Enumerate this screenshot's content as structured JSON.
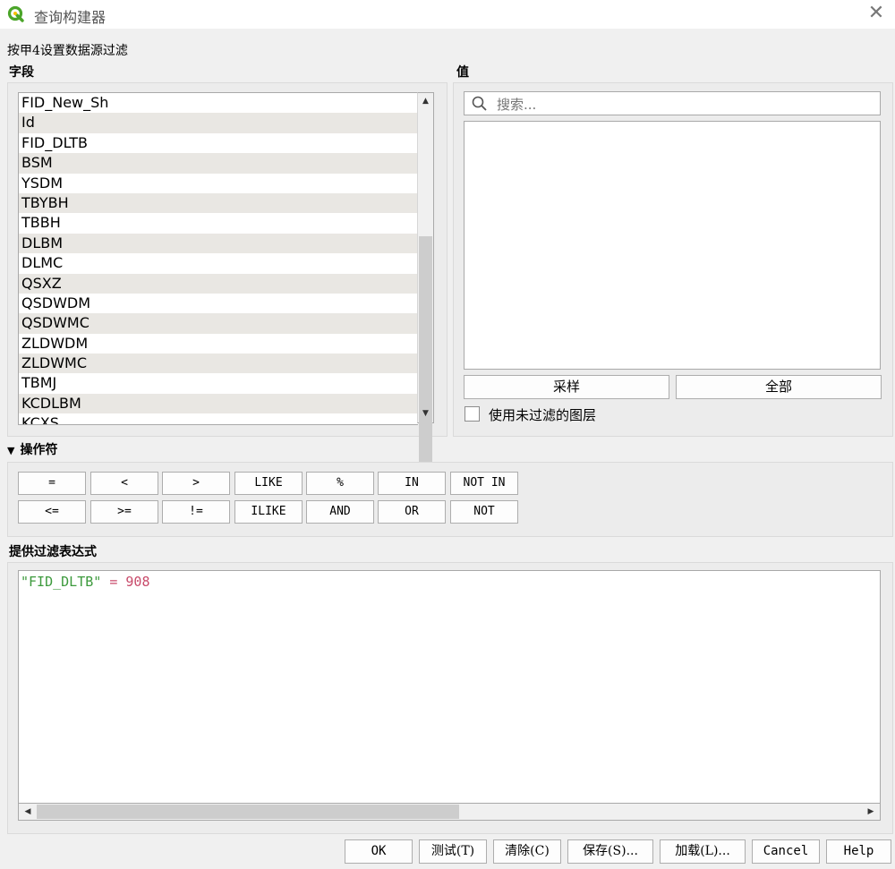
{
  "window": {
    "title": "查询构建器",
    "close_glyph": "✕"
  },
  "source_label": "按甲4设置数据源过滤",
  "fields": {
    "label": "字段",
    "items": [
      "FID_New_Sh",
      "Id",
      "FID_DLTB",
      "BSM",
      "YSDM",
      "TBYBH",
      "TBBH",
      "DLBM",
      "DLMC",
      "QSXZ",
      "QSDWDM",
      "QSDWMC",
      "ZLDWDM",
      "ZLDWMC",
      "TBMJ",
      "KCDLBM",
      "KCXS"
    ]
  },
  "values": {
    "label": "值",
    "search_placeholder": "搜索...",
    "sample_button": "采样",
    "all_button": "全部",
    "use_unfiltered_label": "使用未过滤的图层",
    "use_unfiltered_checked": false
  },
  "operators": {
    "label": "操作符",
    "row1": [
      "=",
      "<",
      ">",
      "LIKE",
      "%",
      "IN",
      "NOT IN"
    ],
    "row2": [
      "<=",
      ">=",
      "!=",
      "ILIKE",
      "AND",
      "OR",
      "NOT"
    ]
  },
  "expression": {
    "label": "提供过滤表达式",
    "field_token": "\"FID_DLTB\"",
    "operator_token": "=",
    "value_token": "908"
  },
  "buttons": {
    "ok": "OK",
    "test": "测试(T)",
    "clear": "清除(C)",
    "save": "保存(S)...",
    "load": "加载(L)...",
    "cancel": "Cancel",
    "help": "Help"
  },
  "icons": {
    "app": "qgis-logo-icon",
    "search": "search-icon",
    "close": "close-icon"
  },
  "colors": {
    "qgis_green": "#4ba52a",
    "expr_field": "#3d9a3d",
    "expr_operator": "#c84a6a"
  }
}
